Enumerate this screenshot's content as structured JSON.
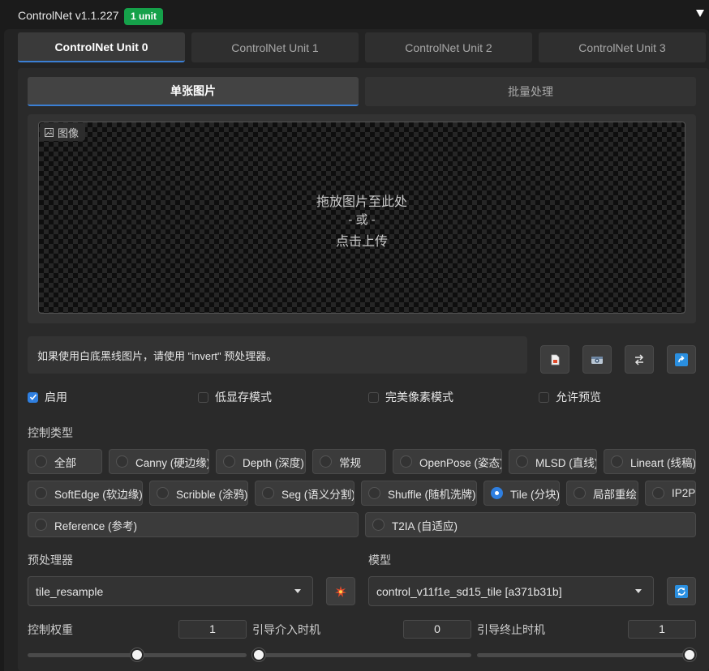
{
  "header": {
    "title": "ControlNet v1.1.227",
    "badge": "1 unit"
  },
  "unit_tabs": [
    {
      "label": "ControlNet Unit 0",
      "active": true
    },
    {
      "label": "ControlNet Unit 1",
      "active": false
    },
    {
      "label": "ControlNet Unit 2",
      "active": false
    },
    {
      "label": "ControlNet Unit 3",
      "active": false
    }
  ],
  "mode_tabs": [
    {
      "label": "单张图片",
      "active": true
    },
    {
      "label": "批量处理",
      "active": false
    }
  ],
  "image": {
    "label": "图像",
    "drop_line1": "拖放图片至此处",
    "drop_line2": "- 或 -",
    "drop_line3": "点击上传"
  },
  "hint": "如果使用白底黑线图片，请使用 \"invert\" 预处理器。",
  "tool_icons": [
    "new-canvas-icon",
    "camera-icon",
    "swap-icon",
    "send-dimensions-icon"
  ],
  "options": [
    {
      "label": "启用",
      "checked": true
    },
    {
      "label": "低显存模式",
      "checked": false
    },
    {
      "label": "完美像素模式",
      "checked": false
    },
    {
      "label": "允许预览",
      "checked": false
    }
  ],
  "control_type": {
    "label": "控制类型",
    "selected": "Tile (分块)",
    "items": [
      "全部",
      "Canny (硬边缘)",
      "Depth (深度)",
      "常规",
      "OpenPose (姿态)",
      "MLSD (直线)",
      "Lineart (线稿)",
      "SoftEdge (软边缘)",
      "Scribble (涂鸦)",
      "Seg (语义分割)",
      "Shuffle (随机洗牌)",
      "Tile (分块)",
      "局部重绘",
      "IP2P",
      "Reference (参考)",
      "T2IA (自适应)"
    ]
  },
  "preprocessor": {
    "label": "预处理器",
    "value": "tile_resample"
  },
  "model": {
    "label": "模型",
    "value": "control_v11f1e_sd15_tile [a371b31b]"
  },
  "sliders": [
    {
      "label": "控制权重",
      "value": "1",
      "min": 0,
      "max": 2,
      "num": 1
    },
    {
      "label": "引导介入时机",
      "value": "0",
      "min": 0,
      "max": 1,
      "num": 0
    },
    {
      "label": "引导终止时机",
      "value": "1",
      "min": 0,
      "max": 1,
      "num": 1
    }
  ],
  "colors": {
    "accent": "#2f7fe0",
    "badge": "#15a14a",
    "fire": "#e04a2a"
  }
}
